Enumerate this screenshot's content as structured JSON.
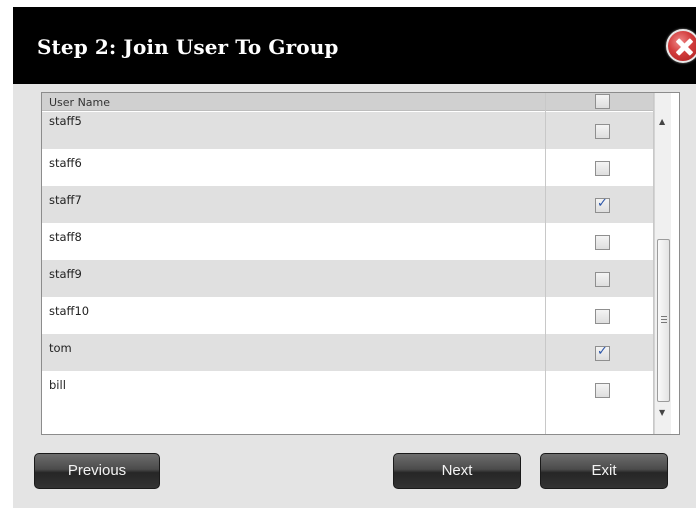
{
  "dialog": {
    "title": "Step 2: Join User To Group"
  },
  "grid": {
    "header": {
      "user_name": "User Name",
      "select_all_checked": false
    },
    "rows": [
      {
        "name": "staff5",
        "checked": false
      },
      {
        "name": "staff6",
        "checked": false
      },
      {
        "name": "staff7",
        "checked": true
      },
      {
        "name": "staff8",
        "checked": false
      },
      {
        "name": "staff9",
        "checked": false
      },
      {
        "name": "staff10",
        "checked": false
      },
      {
        "name": "tom",
        "checked": true
      },
      {
        "name": "bill",
        "checked": false
      }
    ]
  },
  "buttons": {
    "previous": "Previous",
    "next": "Next",
    "exit": "Exit"
  },
  "icons": {
    "close": "close-icon"
  },
  "colors": {
    "title_bar": "#000000",
    "close_button": "#d23c3c",
    "panel": "#e4e4e4"
  }
}
